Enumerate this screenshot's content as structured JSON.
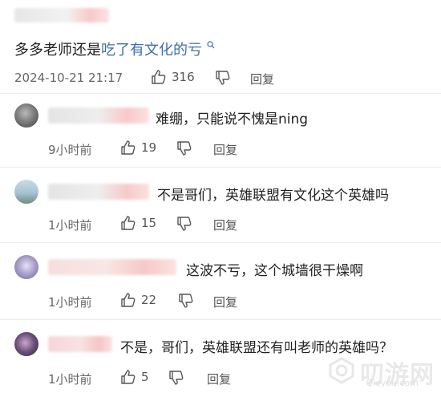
{
  "post": {
    "text_plain": "多多老师还是",
    "text_link": "吃了有文化的亏",
    "timestamp": "2024-10-21 21:17",
    "likes": "316",
    "reply_label": "回复"
  },
  "replies": [
    {
      "text": "难绷，只能说不愧是ning",
      "time": "9小时前",
      "likes": "19",
      "reply_label": "回复"
    },
    {
      "text": "不是哥们，英雄联盟有文化这个英雄吗",
      "time": "1小时前",
      "likes": "15",
      "reply_label": "回复"
    },
    {
      "text": "这波不亏，这个城墙很干燥啊",
      "time": "1小时前",
      "likes": "22",
      "reply_label": "回复"
    },
    {
      "text": "不是，哥们，英雄联盟还有叫老师的英雄吗？",
      "time": "1小时前",
      "likes": "5",
      "reply_label": "回复"
    }
  ],
  "watermark": {
    "main": "叨游网",
    "sub": "Qieyou.com"
  },
  "colors": {
    "link": "#3e6fb0",
    "text": "#222222",
    "meta": "#666666"
  },
  "icons": {
    "like": "thumbs-up-icon",
    "dislike": "thumbs-down-icon",
    "search_hint": "search-icon"
  }
}
